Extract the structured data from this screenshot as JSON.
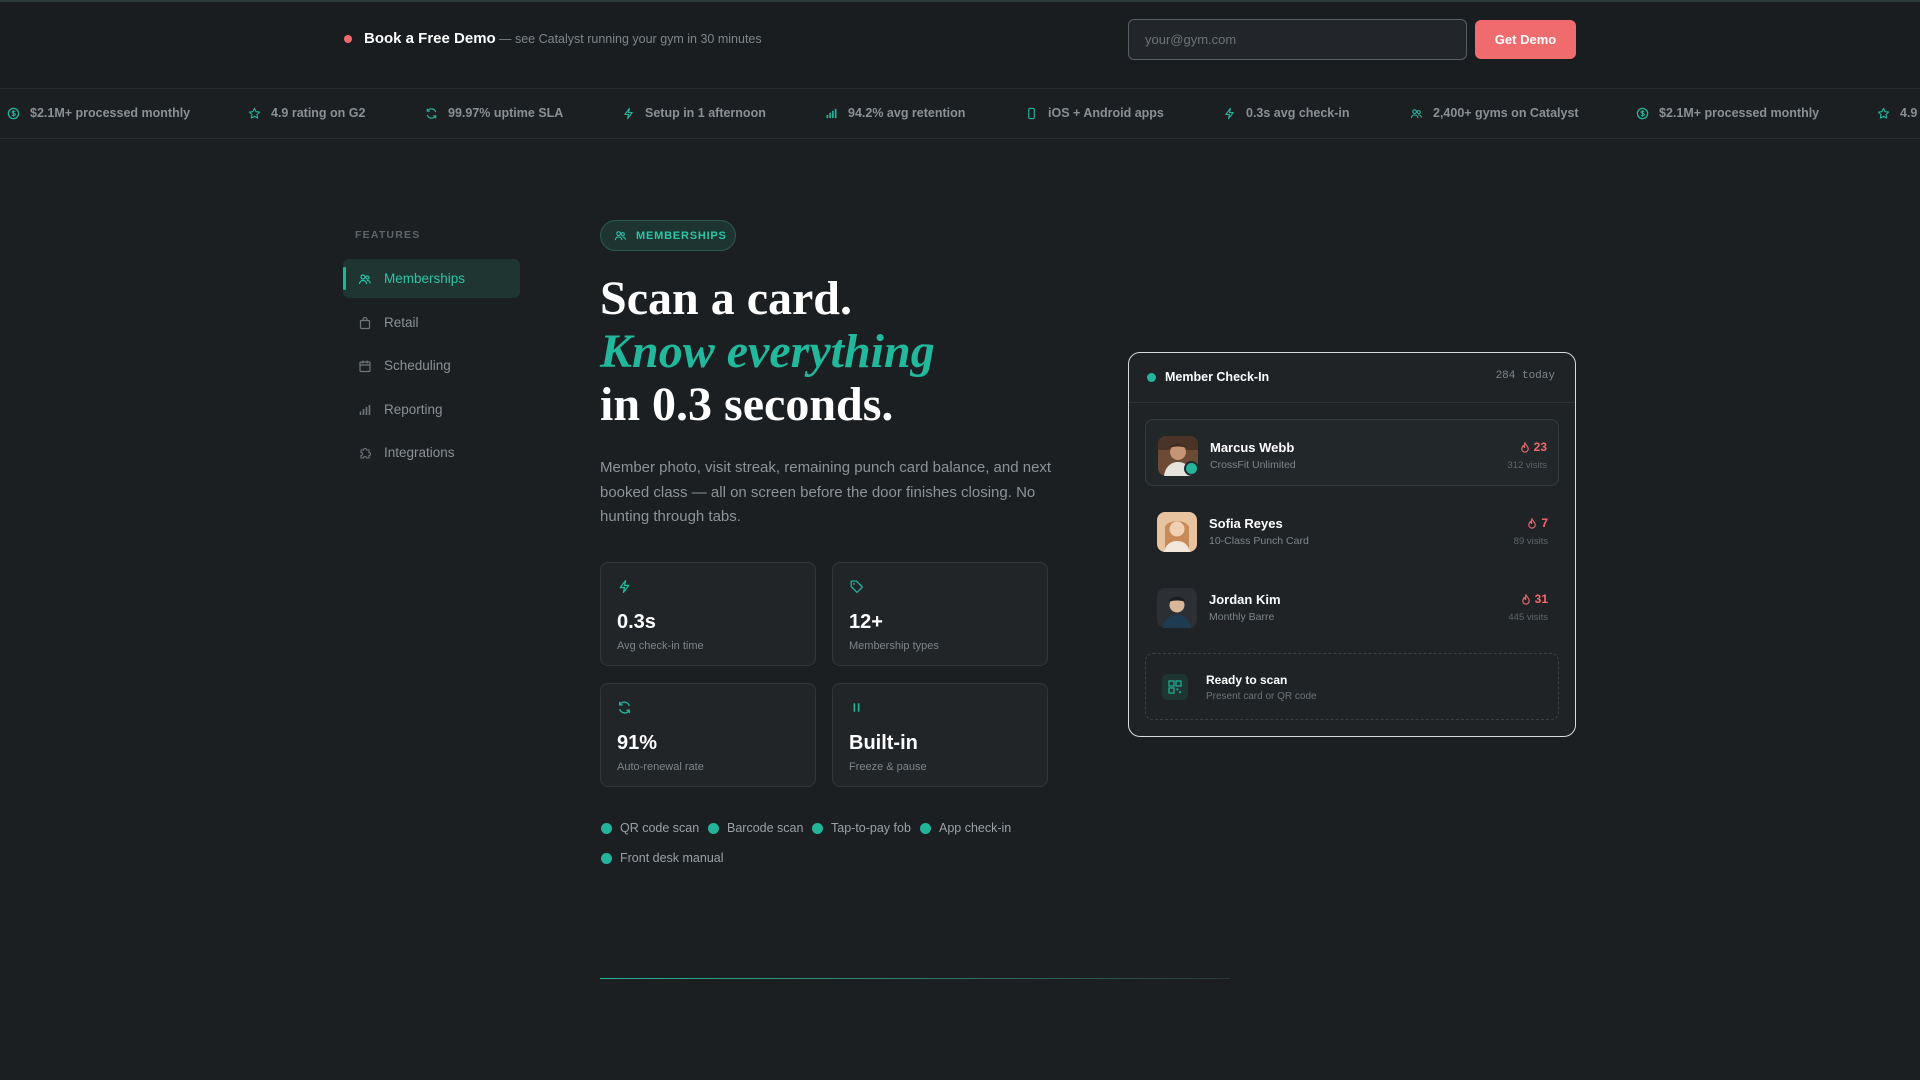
{
  "topbar": {
    "demo_title": "Book a Free Demo",
    "demo_subtitle": "— see Catalyst running your gym in 30 minutes",
    "email_placeholder": "your@gym.com",
    "cta_label": "Get Demo"
  },
  "ticker": [
    {
      "icon": "dollar-icon",
      "text": "$2.1M+ processed monthly"
    },
    {
      "icon": "star-icon",
      "text": "4.9 rating on G2"
    },
    {
      "icon": "refresh-icon",
      "text": "99.97% uptime SLA"
    },
    {
      "icon": "bolt-icon",
      "text": "Setup in 1 afternoon"
    },
    {
      "icon": "bar-chart-icon",
      "text": "94.2% avg retention"
    },
    {
      "icon": "phone-icon",
      "text": "iOS + Android apps"
    },
    {
      "icon": "bolt-icon",
      "text": "0.3s avg check-in"
    },
    {
      "icon": "users-icon",
      "text": "2,400+ gyms on Catalyst"
    },
    {
      "icon": "dollar-icon",
      "text": "$2.1M+ processed monthly"
    },
    {
      "icon": "star-icon",
      "text": "4.9"
    }
  ],
  "sidebar": {
    "label": "FEATURES",
    "items": [
      {
        "label": "Memberships",
        "icon": "users-icon",
        "active": true
      },
      {
        "label": "Retail",
        "icon": "bag-icon",
        "active": false
      },
      {
        "label": "Scheduling",
        "icon": "calendar-icon",
        "active": false
      },
      {
        "label": "Reporting",
        "icon": "bar-chart-icon",
        "active": false
      },
      {
        "label": "Integrations",
        "icon": "puzzle-icon",
        "active": false
      }
    ]
  },
  "main": {
    "badge": "MEMBERSHIPS",
    "headline": {
      "line1": "Scan a card.",
      "line2": "Know everything",
      "line3": "in 0.3 seconds."
    },
    "description": "Member photo, visit streak, remaining punch card balance, and next booked class — all on screen before the door finishes closing. No hunting through tabs.",
    "stats": [
      {
        "icon": "bolt-icon",
        "value": "0.3s",
        "label": "Avg check-in time"
      },
      {
        "icon": "tag-icon",
        "value": "12+",
        "label": "Membership types"
      },
      {
        "icon": "refresh-icon",
        "value": "91%",
        "label": "Auto-renewal rate"
      },
      {
        "icon": "pause-icon",
        "value": "Built-in",
        "label": "Freeze & pause"
      }
    ],
    "chips": [
      "QR code scan",
      "Barcode scan",
      "Tap-to-pay fob",
      "App check-in",
      "Front desk manual"
    ]
  },
  "checkin": {
    "title": "Member Check-In",
    "count": "284 today",
    "members": [
      {
        "name": "Marcus Webb",
        "plan": "CrossFit Unlimited",
        "streak": "23",
        "visits": "312 visits"
      },
      {
        "name": "Sofia Reyes",
        "plan": "10-Class Punch Card",
        "streak": "7",
        "visits": "89 visits"
      },
      {
        "name": "Jordan Kim",
        "plan": "Monthly Barre",
        "streak": "31",
        "visits": "445 visits"
      }
    ],
    "scan": {
      "title": "Ready to scan",
      "subtitle": "Present card or QR code"
    }
  },
  "colors": {
    "accent": "#23b49a",
    "cta": "#f06b6e",
    "background": "#1c1f22"
  }
}
